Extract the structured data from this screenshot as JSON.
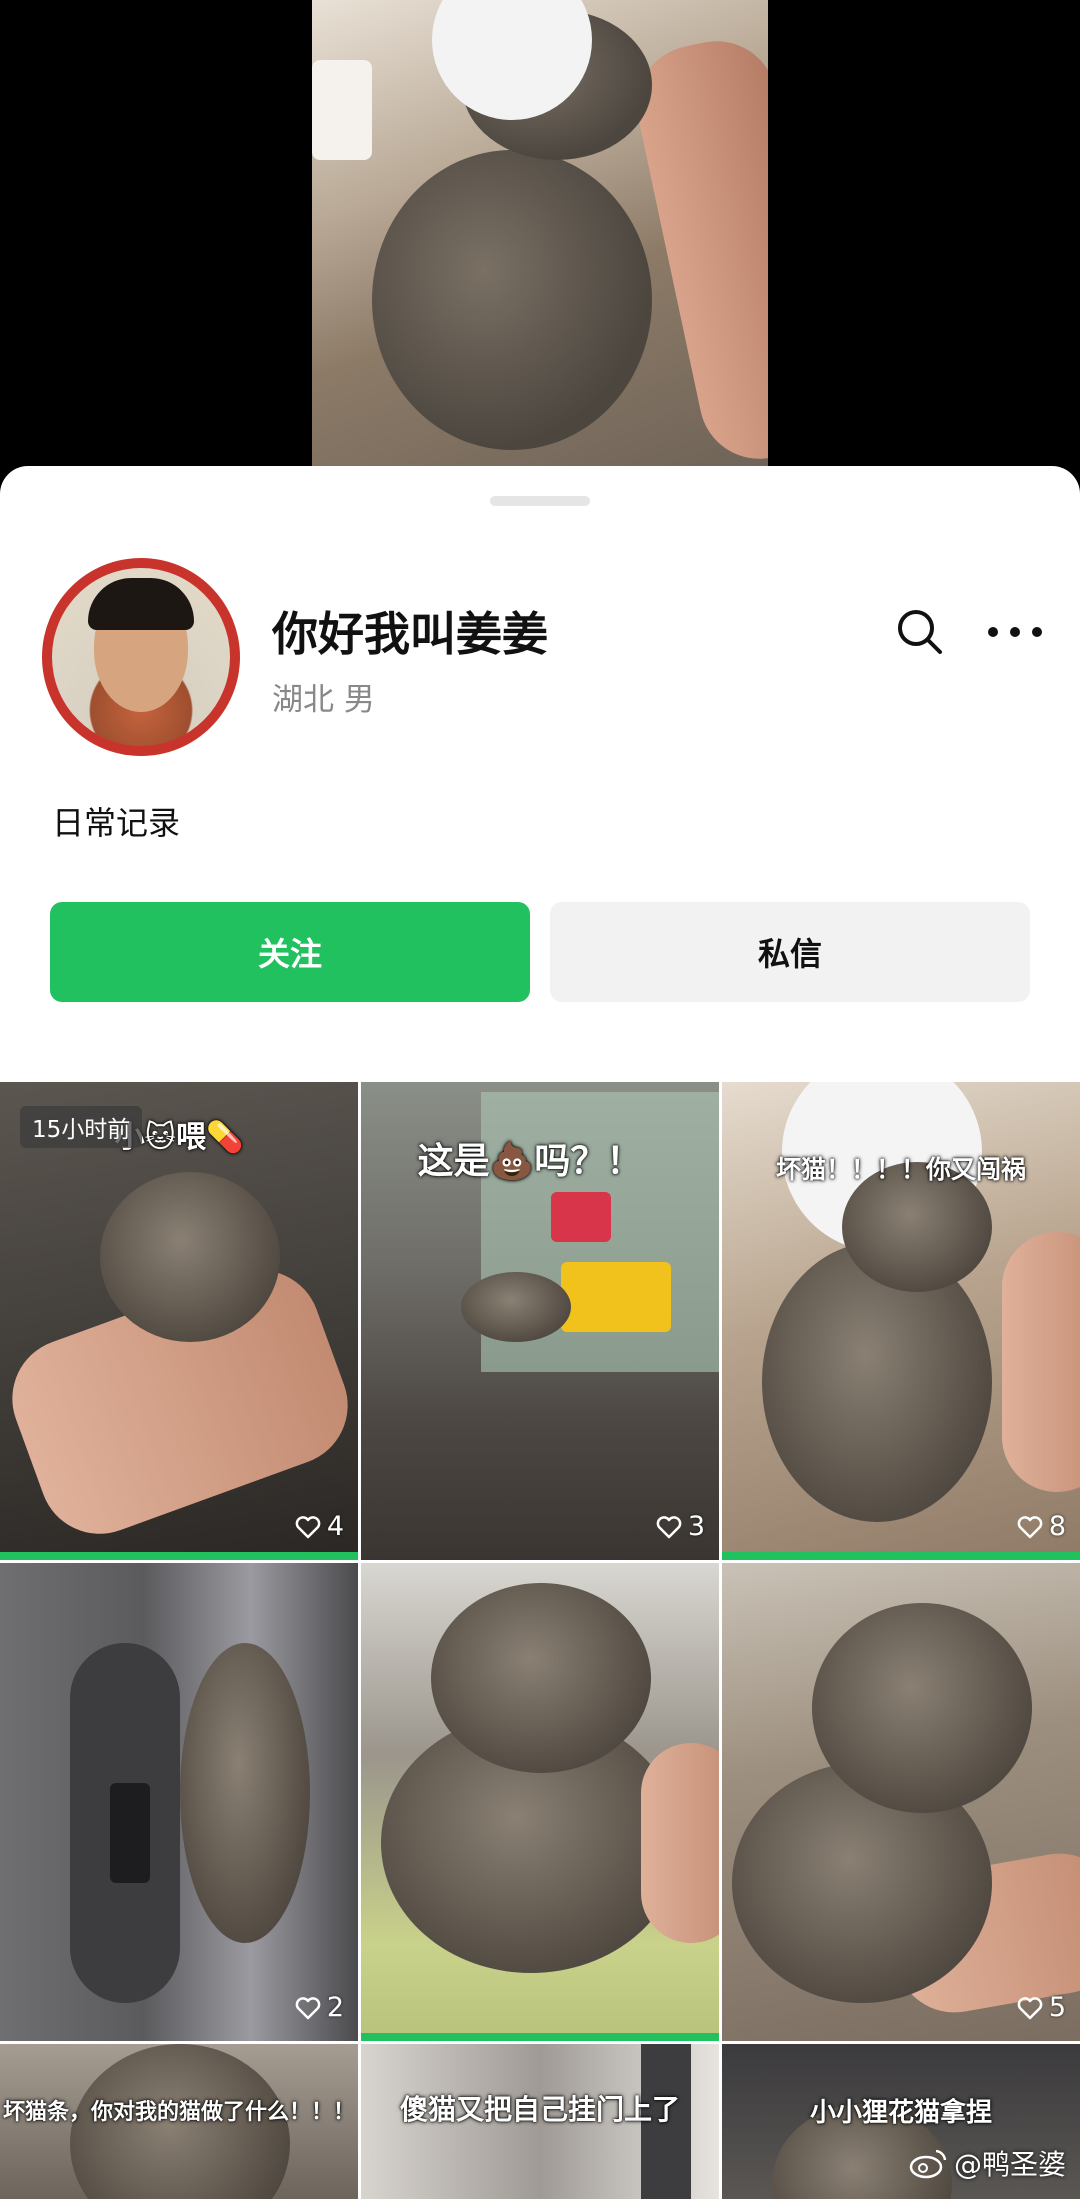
{
  "profile": {
    "name": "你好我叫姜姜",
    "meta": "湖北 男",
    "bio": "日常记录"
  },
  "actions": {
    "follow_label": "关注",
    "message_label": "私信"
  },
  "icons": {
    "search": "search-icon",
    "more": "more-icon",
    "heart": "heart-icon"
  },
  "colors": {
    "accent": "#21c160",
    "avatar_ring": "#c8342c"
  },
  "posts": [
    {
      "caption": "小🐱喂💊",
      "time_badge": "15小时前",
      "likes": "4",
      "watched": true
    },
    {
      "caption": "这是💩吗？！",
      "likes": "3",
      "watched": false
    },
    {
      "caption": "坏猫！！！！你又闯祸",
      "likes": "8",
      "watched": true
    },
    {
      "caption": "",
      "likes": "2",
      "watched": false
    },
    {
      "caption": "",
      "likes": "",
      "watched": true
    },
    {
      "caption": "",
      "likes": "5",
      "watched": false
    },
    {
      "caption": "坏猫条，你对我的猫做了什么！！！",
      "likes": "",
      "watched": false
    },
    {
      "caption": "傻猫又把自己挂门上了",
      "likes": "",
      "watched": false
    },
    {
      "caption": "小小狸花猫拿捏",
      "likes": "",
      "watched": false
    }
  ],
  "watermark": "@鸭圣婆"
}
